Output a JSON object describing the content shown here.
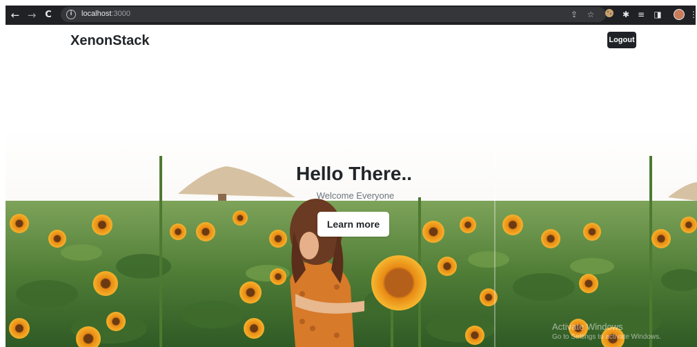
{
  "browser": {
    "url_host": "localhost",
    "url_port": ":3000",
    "back_glyph": "←",
    "forward_glyph": "→",
    "reload_glyph": "C",
    "info_glyph": "i",
    "share_glyph": "⇪",
    "star_glyph": "☆",
    "puzzle_glyph": "✱",
    "media_glyph": "≡",
    "sidepanel_glyph": "◨",
    "menu_glyph": "⋮"
  },
  "navbar": {
    "brand": "XenonStack",
    "logout_label": "Logout"
  },
  "hero": {
    "title": "Hello There..",
    "subtitle": "Welcome Everyone",
    "cta_label": "Learn more"
  },
  "watermark": {
    "line1": "Activate Windows",
    "line2": "Go to Settings to activate Windows."
  },
  "colors": {
    "chrome_bg": "#202124",
    "brand_text": "#212529",
    "logout_bg": "#1f2327",
    "sunflower": "#f0a020",
    "foliage": "#5a8a3c"
  }
}
